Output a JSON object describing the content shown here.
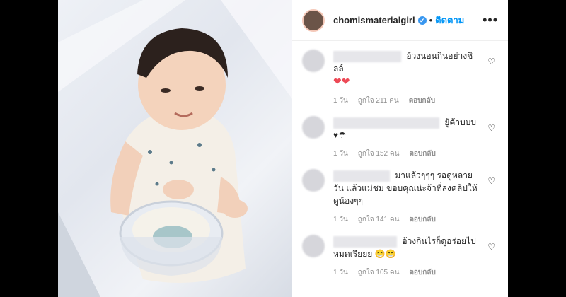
{
  "header": {
    "username": "chomismaterialgirl",
    "verified_mark": "✔",
    "separator": "•",
    "follow_label": "ติดตาม",
    "more_label": "•••"
  },
  "comments": [
    {
      "text": "อ้วงนอนกินอย่างชิลล์",
      "emoji": "❤❤",
      "time": "1 วัน",
      "likes": "ถูกใจ 211 คน",
      "reply": "ตอบกลับ"
    },
    {
      "text": "ยู้ค้าบบบ",
      "emoji": "♥☂",
      "time": "1 วัน",
      "likes": "ถูกใจ 152 คน",
      "reply": "ตอบกลับ"
    },
    {
      "text": "มาแล้วๆๆๆ รอดูหลายวัน แล้วแม่ชม ขอบคุณน่ะจ้าที่ลงคลิปให้ดูน้องๆๆ",
      "emoji": "",
      "time": "1 วัน",
      "likes": "ถูกใจ 141 คน",
      "reply": "ตอบกลับ"
    },
    {
      "text": "อ้วงกินไรก็ดูอร่อยไปหมดเรียยย",
      "emoji": "😁😁",
      "time": "1 วัน",
      "likes": "ถูกใจ 105 คน",
      "reply": "ตอบกลับ"
    }
  ],
  "icons": {
    "heart": "♡"
  }
}
